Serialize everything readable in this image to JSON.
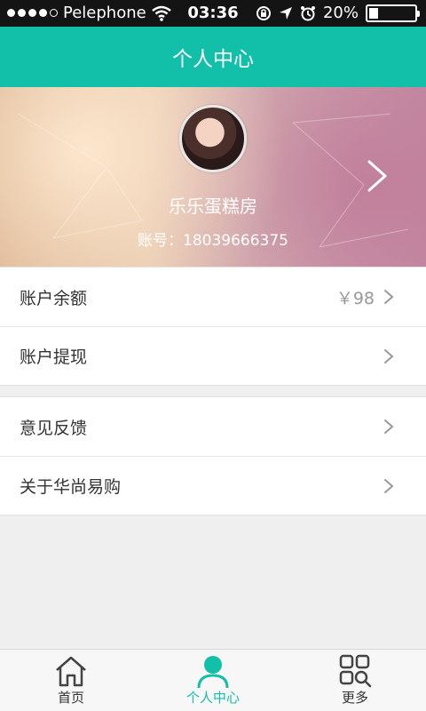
{
  "status_bar": {
    "carrier": "Pelephone",
    "time": "03:36",
    "battery": "20%"
  },
  "header": {
    "title": "个人中心"
  },
  "profile": {
    "name": "乐乐蛋糕房",
    "account": "账号：18039666375"
  },
  "menu_group1": [
    {
      "label": "账户余额",
      "value": "￥98"
    },
    {
      "label": "账户提现"
    }
  ],
  "menu_group2": [
    {
      "label": "意见反馈"
    },
    {
      "label": "关于华尚易购"
    }
  ],
  "tabs": [
    {
      "label": "首页",
      "icon": "home-icon"
    },
    {
      "label": "个人中心",
      "icon": "user-icon"
    },
    {
      "label": "更多",
      "icon": "more-icon"
    }
  ],
  "colors": {
    "accent": "#12bfa8",
    "status_bar": "#141414"
  }
}
